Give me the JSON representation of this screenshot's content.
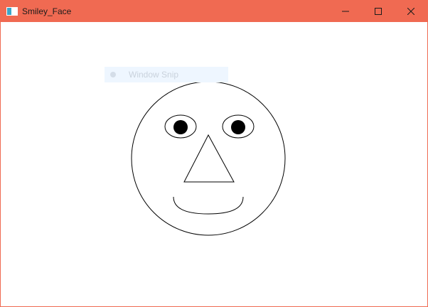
{
  "window": {
    "title": "Smiley_Face",
    "accent_color": "#f06a52",
    "controls": {
      "minimize": "minimize-icon",
      "maximize": "maximize-icon",
      "close": "close-icon"
    }
  },
  "overlay": {
    "label": "Window Snip",
    "icon": "snip-icon"
  },
  "canvas": {
    "shapes": [
      "face-circle",
      "left-eye",
      "right-eye",
      "nose-triangle",
      "mouth-arc"
    ]
  }
}
